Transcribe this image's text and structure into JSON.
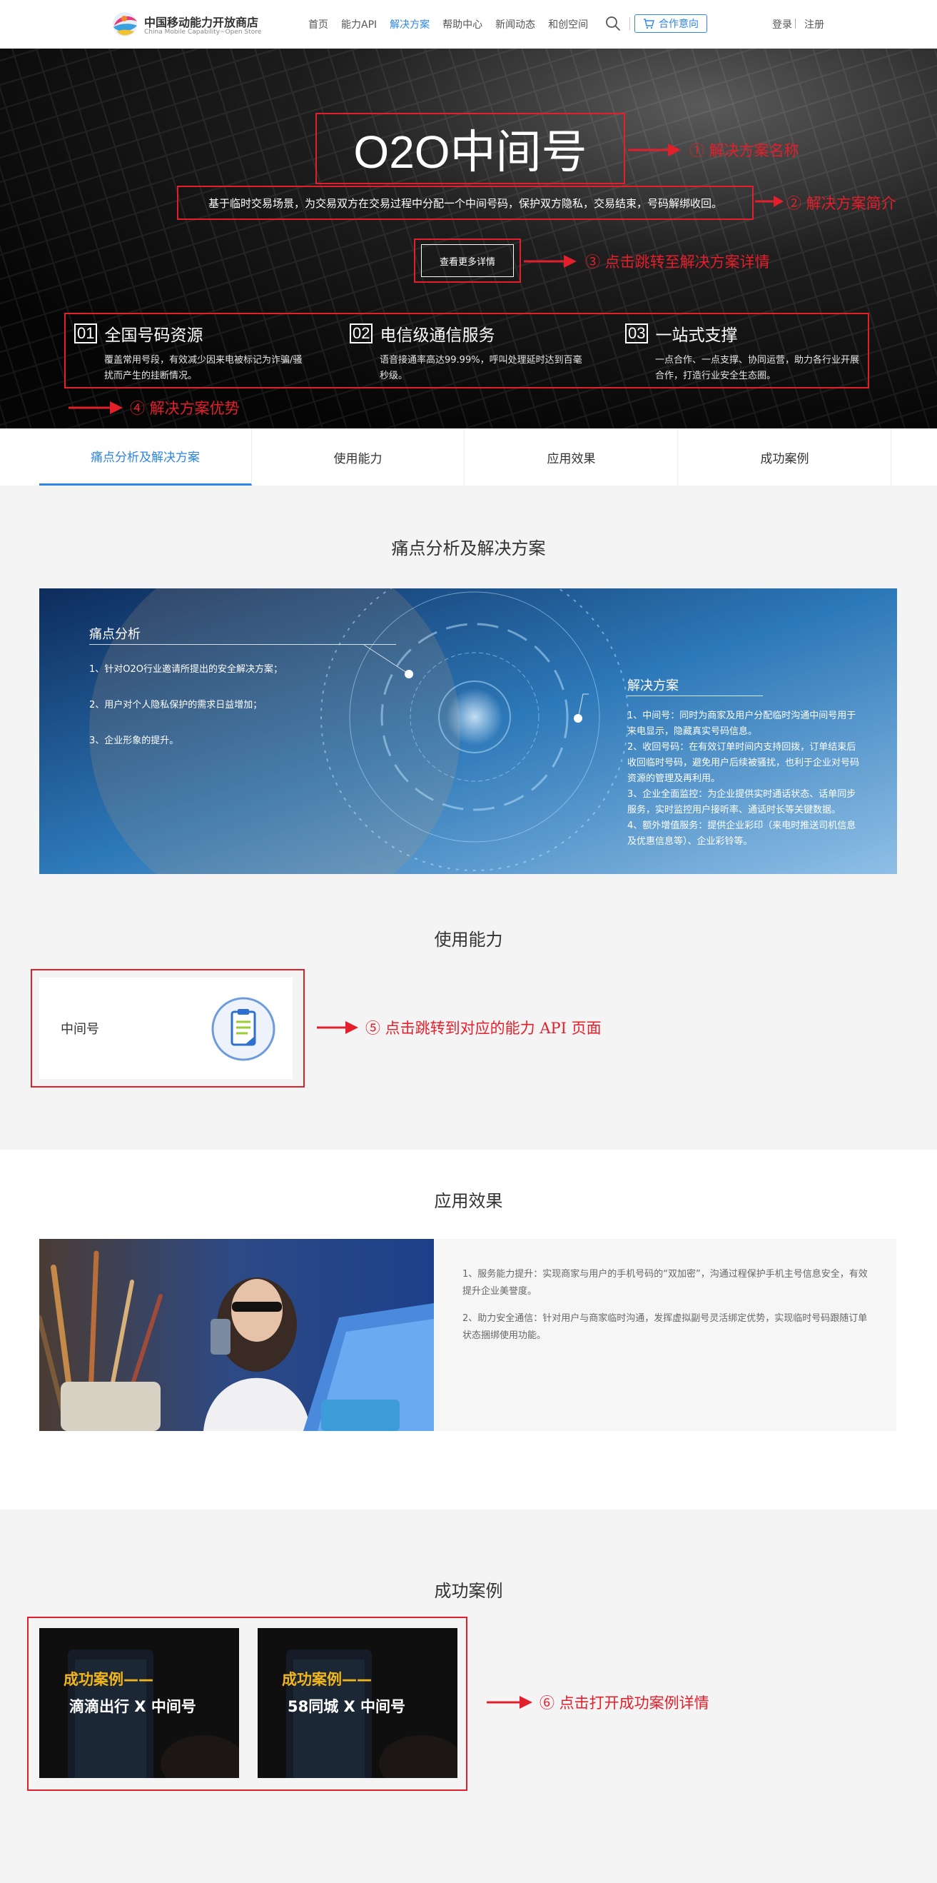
{
  "header": {
    "logo_cn": "中国移动能力开放商店",
    "logo_en": "China Mobile Capability~Open Store",
    "nav": [
      "首页",
      "能力API",
      "解决方案",
      "帮助中心",
      "新闻动态",
      "和创空间"
    ],
    "active_nav": "解决方案",
    "coop_label": "合作意向",
    "login": "登录",
    "register": "注册"
  },
  "hero": {
    "title": "O2O中间号",
    "desc": "基于临时交易场景，为交易双方在交易过程中分配一个中间号码，保护双方隐私，交易结束，号码解绑收回。",
    "btn": "查看更多详情",
    "advantages": [
      {
        "num": "01",
        "title": "全国号码资源",
        "text": "覆盖常用号段，有效减少因来电被标记为诈骗/骚扰而产生的挂断情况。"
      },
      {
        "num": "02",
        "title": "电信级通信服务",
        "text": "语音接通率高达99.99%，呼叫处理延时达到百毫秒级。"
      },
      {
        "num": "03",
        "title": "一站式支撑",
        "text": "一点合作、一点支撑、协同运营，助力各行业开展合作，打造行业安全生态圈。"
      }
    ]
  },
  "annotations": {
    "a1": "① 解决方案名称",
    "a2": "② 解决方案简介",
    "a3": "③ 点击跳转至解决方案详情",
    "a4": "④ 解决方案优势",
    "a5": "⑤ 点击跳转到对应的能力 API 页面",
    "a6": "⑥ 点击打开成功案例详情"
  },
  "annotation_color": "#e41f2c",
  "accent_color": "#2f86e6",
  "tabs": [
    "痛点分析及解决方案",
    "使用能力",
    "应用效果",
    "成功案例"
  ],
  "pain": {
    "title": "痛点分析及解决方案",
    "left_title": "痛点分析",
    "left_items": [
      "1、针对O2O行业邀请所提出的安全解决方案；",
      "2、用户对个人隐私保护的需求日益增加；",
      "3、企业形象的提升。"
    ],
    "right_title": "解决方案",
    "right_items": [
      "1、中间号：同时为商家及用户分配临时沟通中间号用于来电显示，隐藏真实号码信息。",
      "2、收回号码：在有效订单时间内支持回拨，订单结束后收回临时号码，避免用户后续被骚扰，也利于企业对号码资源的管理及再利用。",
      "3、企业全面监控：为企业提供实时通话状态、话单同步服务，实时监控用户接听率、通话时长等关键数据。",
      "4、额外增值服务：提供企业彩印（来电时推送司机信息及优惠信息等）、企业彩铃等。"
    ]
  },
  "ability": {
    "title": "使用能力",
    "card_name": "中间号",
    "icon": "document-icon"
  },
  "effect": {
    "title": "应用效果",
    "items": [
      "1、服务能力提升：实现商家与用户的手机号码的“双加密”，沟通过程保护手机主号信息安全，有效提升企业美誉度。",
      "2、助力安全通信：针对用户与商家临时沟通，发挥虚拟副号灵活绑定优势，实现临时号码跟随订单状态捆绑使用功能。"
    ]
  },
  "cases": {
    "title": "成功案例",
    "items": [
      {
        "kicker": "成功案例——",
        "title": "滴滴出行 X 中间号"
      },
      {
        "kicker": "成功案例——",
        "title": "58同城 X 中间号"
      }
    ]
  }
}
